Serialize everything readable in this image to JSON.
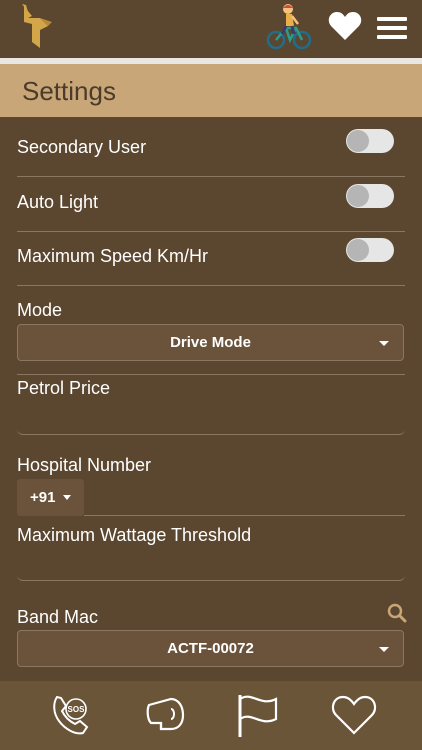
{
  "header": {
    "icons": [
      "logo-icon",
      "rider-icon",
      "heart-icon",
      "menu-icon"
    ]
  },
  "settings": {
    "title": "Settings",
    "secondary_user": {
      "label": "Secondary User",
      "enabled": false
    },
    "auto_light": {
      "label": "Auto Light",
      "enabled": false
    },
    "max_speed": {
      "label": "Maximum Speed Km/Hr",
      "enabled": false
    },
    "mode": {
      "label": "Mode",
      "value": "Drive Mode"
    },
    "petrol_price": {
      "label": "Petrol Price",
      "value": ""
    },
    "hospital_number": {
      "label": "Hospital Number",
      "country_code": "+91",
      "value": ""
    },
    "max_wattage": {
      "label": "Maximum Wattage Threshold",
      "value": ""
    },
    "band_mac": {
      "label": "Band Mac",
      "value": "ACTF-00072"
    }
  },
  "bottom_nav": {
    "items": [
      "sos-icon",
      "horn-icon",
      "flag-icon",
      "heart-icon"
    ],
    "sos_text": "SOS"
  },
  "colors": {
    "background": "#5b4630",
    "accent_band": "#c8a677",
    "title_text": "#4a3b2b",
    "bottom_bar": "#6b5539",
    "logo": "#d4a64a"
  }
}
